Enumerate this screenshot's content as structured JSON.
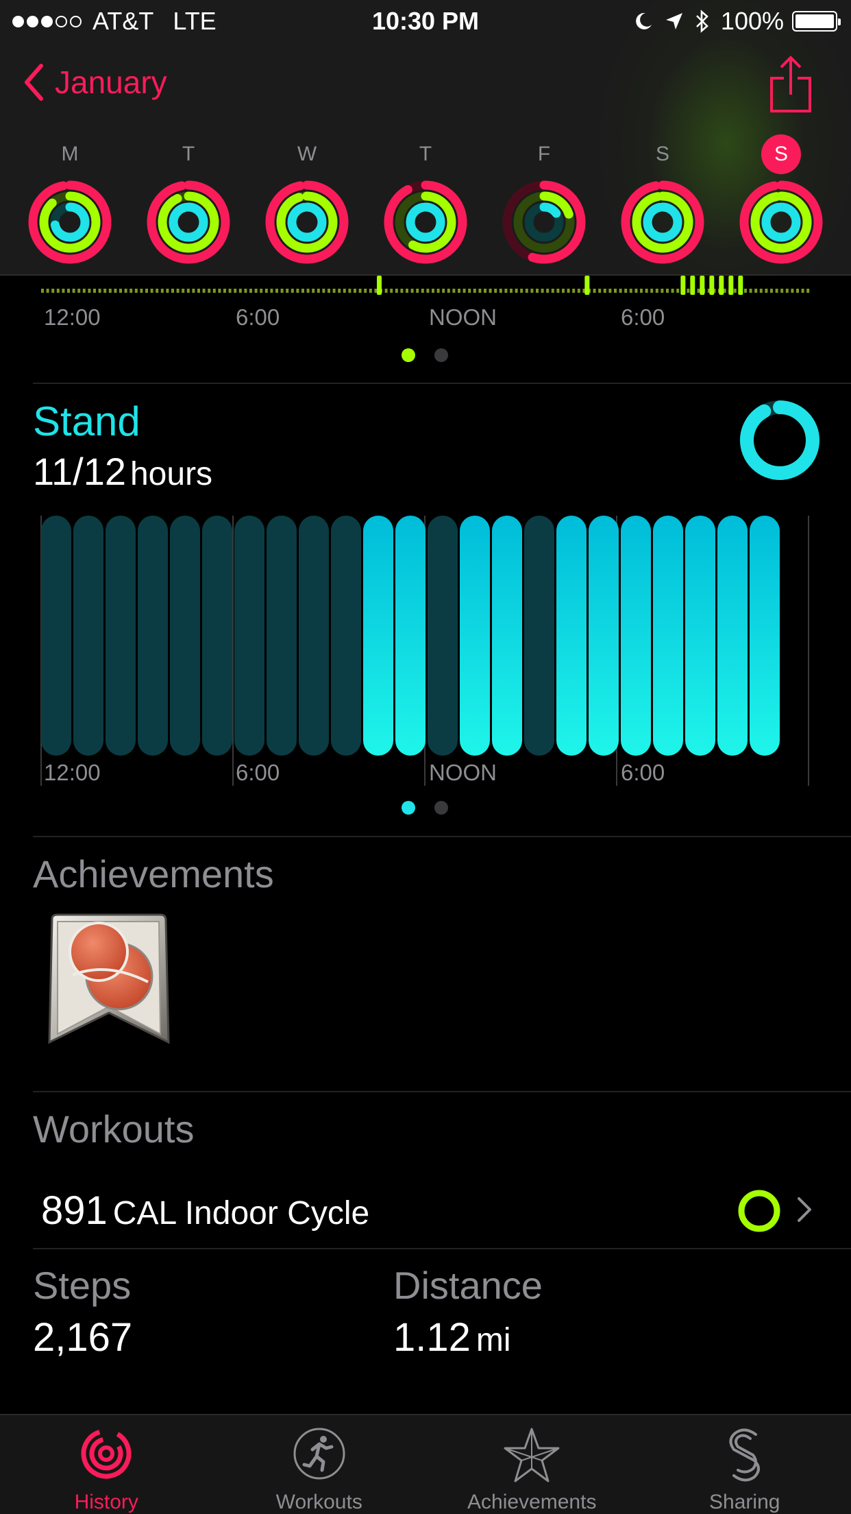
{
  "status_bar": {
    "signal_bars": 5,
    "signal_filled": 3,
    "carrier": "AT&T",
    "network": "LTE",
    "time": "10:30 PM",
    "battery_percent": "100%"
  },
  "nav": {
    "back_label": "January",
    "accent_color": "#fa1c5a"
  },
  "week": [
    {
      "letter": "M",
      "today": false,
      "move": 0.97,
      "exercise": 0.88,
      "stand": 0.72
    },
    {
      "letter": "T",
      "today": false,
      "move": 0.97,
      "exercise": 0.93,
      "stand": 0.97
    },
    {
      "letter": "W",
      "today": false,
      "move": 0.97,
      "exercise": 0.95,
      "stand": 0.97
    },
    {
      "letter": "T",
      "today": false,
      "move": 0.92,
      "exercise": 0.58,
      "stand": 0.97
    },
    {
      "letter": "F",
      "today": false,
      "move": 0.55,
      "exercise": 0.2,
      "stand": 0.15
    },
    {
      "letter": "S",
      "today": false,
      "move": 0.97,
      "exercise": 0.97,
      "stand": 0.97
    },
    {
      "letter": "S",
      "today": true,
      "move": 0.97,
      "exercise": 0.97,
      "stand": 0.97
    }
  ],
  "move_timeline": {
    "hour_labels": [
      "12:00",
      "6:00",
      "NOON",
      "6:00"
    ],
    "active_hours": [
      10.5,
      17.0,
      20.0,
      20.3,
      20.6,
      20.9,
      21.2,
      21.5,
      21.8
    ],
    "page_index": 0,
    "page_count": 2
  },
  "stand": {
    "title": "Stand",
    "value": "11/12",
    "unit": "hours",
    "progress": 0.92,
    "hour_labels": [
      "12:00",
      "6:00",
      "NOON",
      "6:00"
    ],
    "hours_stood": [
      0,
      0,
      0,
      0,
      0,
      0,
      0,
      0,
      0,
      0,
      1,
      1,
      0,
      1,
      1,
      0,
      1,
      1,
      1,
      1,
      1,
      1,
      1
    ],
    "page_index": 0,
    "page_count": 2
  },
  "achievements": {
    "title": "Achievements",
    "badges": [
      {
        "icon": "rings-achievement-badge-icon"
      }
    ]
  },
  "workouts": {
    "title": "Workouts",
    "items": [
      {
        "calories": "891",
        "unit": "CAL",
        "name": "Indoor Cycle"
      }
    ]
  },
  "stats": {
    "steps_label": "Steps",
    "steps_value": "2,167",
    "distance_label": "Distance",
    "distance_value": "1.12",
    "distance_unit": "mi"
  },
  "tabs": [
    {
      "label": "History",
      "icon": "history-icon",
      "active": true
    },
    {
      "label": "Workouts",
      "icon": "workouts-icon",
      "active": false
    },
    {
      "label": "Achievements",
      "icon": "achievements-icon",
      "active": false
    },
    {
      "label": "Sharing",
      "icon": "sharing-icon",
      "active": false
    }
  ],
  "colors": {
    "move": "#fa1c5a",
    "exercise": "#a5ff00",
    "stand": "#1fe3e8"
  }
}
